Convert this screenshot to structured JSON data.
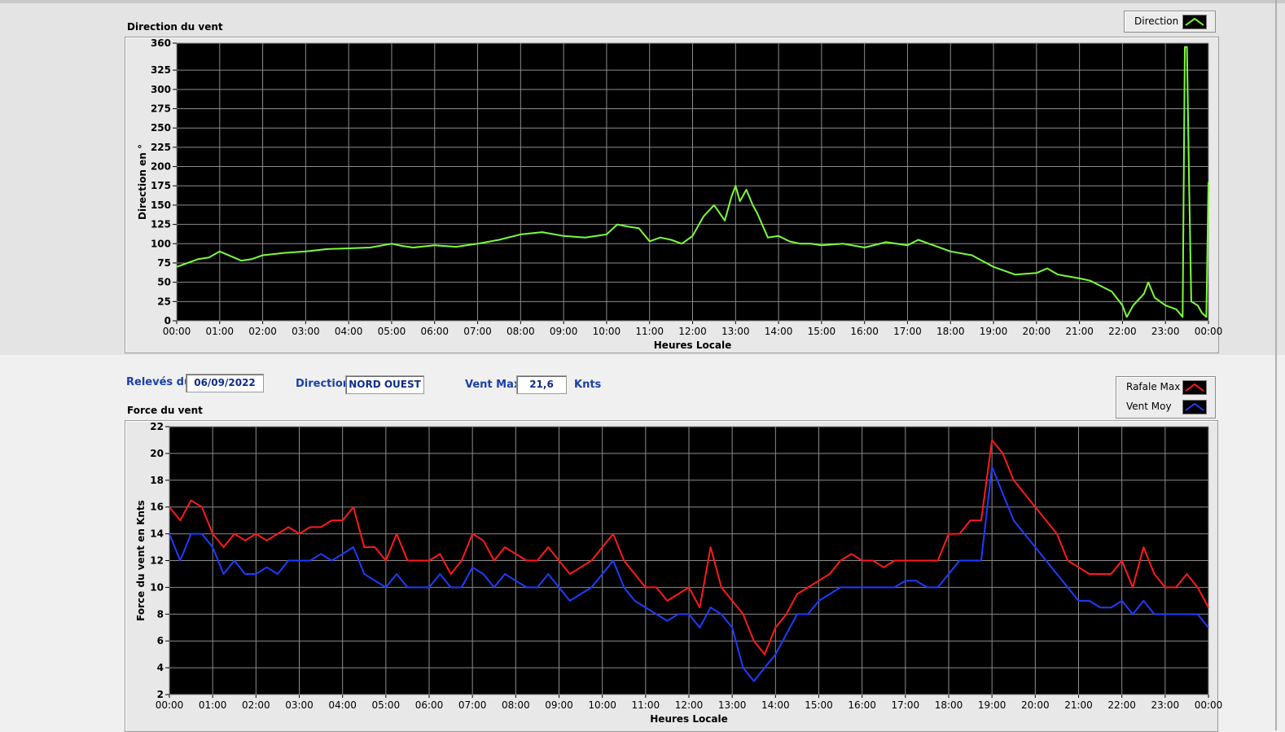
{
  "info_bar": {
    "date_label": "Relevés du",
    "date_value": "06/09/2022",
    "direction_label": "Direction",
    "direction_value": "NORD OUEST",
    "vent_max_label": "Vent Max",
    "vent_max_value": "21,6",
    "vent_max_unit": "Knts"
  },
  "colors": {
    "direction": "#7cfc3c",
    "rafale": "#ff1a1a",
    "vent_moy": "#1e3cff",
    "plot_bg": "#000000",
    "grid": "#8c8c8c",
    "label_blue": "#1a3fa8"
  },
  "chart_data": [
    {
      "type": "line",
      "title": "Direction du vent",
      "xlabel": "Heures Locale",
      "ylabel": "Direction en °",
      "x_ticks": [
        "00:00",
        "01:00",
        "02:00",
        "03:00",
        "04:00",
        "05:00",
        "06:00",
        "07:00",
        "08:00",
        "09:00",
        "10:00",
        "11:00",
        "12:00",
        "13:00",
        "14:00",
        "15:00",
        "16:00",
        "17:00",
        "18:00",
        "19:00",
        "20:00",
        "21:00",
        "22:00",
        "23:00",
        "00:00"
      ],
      "y_ticks": [
        "0",
        "25",
        "50",
        "75",
        "100",
        "125",
        "150",
        "175",
        "200",
        "225",
        "250",
        "275",
        "300",
        "325",
        "360"
      ],
      "ylim": [
        0,
        360
      ],
      "xlim": [
        0,
        24
      ],
      "grid": true,
      "legend_position": "top-right",
      "series": [
        {
          "name": "Direction",
          "x": [
            0,
            0.25,
            0.5,
            0.75,
            1,
            1.25,
            1.5,
            1.75,
            2,
            2.5,
            3,
            3.5,
            4,
            4.5,
            5,
            5.25,
            5.5,
            6,
            6.5,
            7,
            7.5,
            8,
            8.5,
            9,
            9.5,
            10,
            10.25,
            10.5,
            10.75,
            11,
            11.25,
            11.5,
            11.75,
            12,
            12.25,
            12.5,
            12.75,
            12.9,
            13,
            13.1,
            13.25,
            13.4,
            13.5,
            13.75,
            14,
            14.25,
            14.5,
            14.75,
            15,
            15.5,
            16,
            16.5,
            17,
            17.25,
            17.5,
            18,
            18.5,
            19,
            19.5,
            20,
            20.25,
            20.5,
            21,
            21.25,
            21.5,
            21.75,
            22,
            22.1,
            22.25,
            22.5,
            22.6,
            22.75,
            23,
            23.25,
            23.4,
            23.45,
            23.5,
            23.55,
            23.6,
            23.75,
            23.85,
            23.95,
            24
          ],
          "y": [
            70,
            75,
            80,
            82,
            90,
            84,
            78,
            80,
            85,
            88,
            90,
            93,
            94,
            95,
            100,
            97,
            95,
            98,
            96,
            100,
            105,
            112,
            115,
            110,
            108,
            112,
            125,
            122,
            120,
            103,
            108,
            105,
            100,
            110,
            135,
            150,
            130,
            160,
            175,
            155,
            170,
            150,
            140,
            108,
            110,
            103,
            100,
            100,
            98,
            100,
            95,
            102,
            98,
            105,
            100,
            90,
            85,
            70,
            60,
            62,
            68,
            60,
            55,
            52,
            45,
            38,
            20,
            5,
            20,
            35,
            50,
            30,
            20,
            15,
            5,
            355,
            355,
            180,
            25,
            20,
            10,
            5,
            180
          ]
        }
      ]
    },
    {
      "type": "line",
      "title": "Force du vent",
      "xlabel": "Heures Locale",
      "ylabel": "Force du vent en Knts",
      "x_ticks": [
        "00:00",
        "01:00",
        "02:00",
        "03:00",
        "04:00",
        "05:00",
        "06:00",
        "07:00",
        "08:00",
        "09:00",
        "10:00",
        "11:00",
        "12:00",
        "13:00",
        "14:00",
        "15:00",
        "16:00",
        "17:00",
        "18:00",
        "19:00",
        "20:00",
        "21:00",
        "22:00",
        "23:00",
        "00:00"
      ],
      "y_ticks": [
        "2",
        "4",
        "6",
        "8",
        "10",
        "12",
        "14",
        "16",
        "18",
        "20",
        "22"
      ],
      "ylim": [
        2,
        22
      ],
      "xlim": [
        0,
        24
      ],
      "grid": true,
      "legend_position": "top-right",
      "x": [
        0,
        0.25,
        0.5,
        0.75,
        1,
        1.25,
        1.5,
        1.75,
        2,
        2.25,
        2.5,
        2.75,
        3,
        3.25,
        3.5,
        3.75,
        4,
        4.25,
        4.5,
        4.75,
        5,
        5.25,
        5.5,
        5.75,
        6,
        6.25,
        6.5,
        6.75,
        7,
        7.25,
        7.5,
        7.75,
        8,
        8.25,
        8.5,
        8.75,
        9,
        9.25,
        9.5,
        9.75,
        10,
        10.25,
        10.5,
        10.75,
        11,
        11.25,
        11.5,
        11.75,
        12,
        12.25,
        12.5,
        12.75,
        13,
        13.25,
        13.5,
        13.75,
        14,
        14.25,
        14.5,
        14.75,
        15,
        15.25,
        15.5,
        15.75,
        16,
        16.25,
        16.5,
        16.75,
        17,
        17.25,
        17.5,
        17.75,
        18,
        18.25,
        18.5,
        18.75,
        19,
        19.25,
        19.5,
        19.75,
        20,
        20.25,
        20.5,
        20.75,
        21,
        21.25,
        21.5,
        21.75,
        22,
        22.25,
        22.5,
        22.75,
        23,
        23.25,
        23.5,
        23.75,
        24
      ],
      "series": [
        {
          "name": "Rafale Max",
          "values": [
            16,
            15,
            16.5,
            16,
            14,
            13,
            14,
            13.5,
            14,
            13.5,
            14,
            14.5,
            14,
            14.5,
            14.5,
            15,
            15,
            16,
            13,
            13,
            12,
            14,
            12,
            12,
            12,
            12.5,
            11,
            12,
            14,
            13.5,
            12,
            13,
            12.5,
            12,
            12,
            13,
            12,
            11,
            11.5,
            12,
            13,
            14,
            12,
            11,
            10,
            10,
            9,
            9.5,
            10,
            8.5,
            13,
            10,
            9,
            8,
            6,
            5,
            7,
            8,
            9.5,
            10,
            10.5,
            11,
            12,
            12.5,
            12,
            12,
            11.5,
            12,
            12,
            12,
            12,
            12,
            14,
            14,
            15,
            15,
            21,
            20,
            18,
            17,
            16,
            15,
            14,
            12,
            11.5,
            11,
            11,
            11,
            12,
            10,
            13,
            11,
            10,
            10,
            11,
            10,
            8.5
          ]
        },
        {
          "name": "Vent Moy",
          "values": [
            14,
            12,
            14,
            14,
            13,
            11,
            12,
            11,
            11,
            11.5,
            11,
            12,
            12,
            12,
            12.5,
            12,
            12.5,
            13,
            11,
            10.5,
            10,
            11,
            10,
            10,
            10,
            11,
            10,
            10,
            11.5,
            11,
            10,
            11,
            10.5,
            10,
            10,
            11,
            10,
            9,
            9.5,
            10,
            11,
            12,
            10,
            9,
            8.5,
            8,
            7.5,
            8,
            8,
            7,
            8.5,
            8,
            7,
            4,
            3,
            4,
            5,
            6.5,
            8,
            8,
            9,
            9.5,
            10,
            10,
            10,
            10,
            10,
            10,
            10.5,
            10.5,
            10,
            10,
            11,
            12,
            12,
            12,
            19,
            17,
            15,
            14,
            13,
            12,
            11,
            10,
            9,
            9,
            8.5,
            8.5,
            9,
            8,
            9,
            8,
            8,
            8,
            8,
            8,
            7
          ]
        }
      ]
    }
  ]
}
